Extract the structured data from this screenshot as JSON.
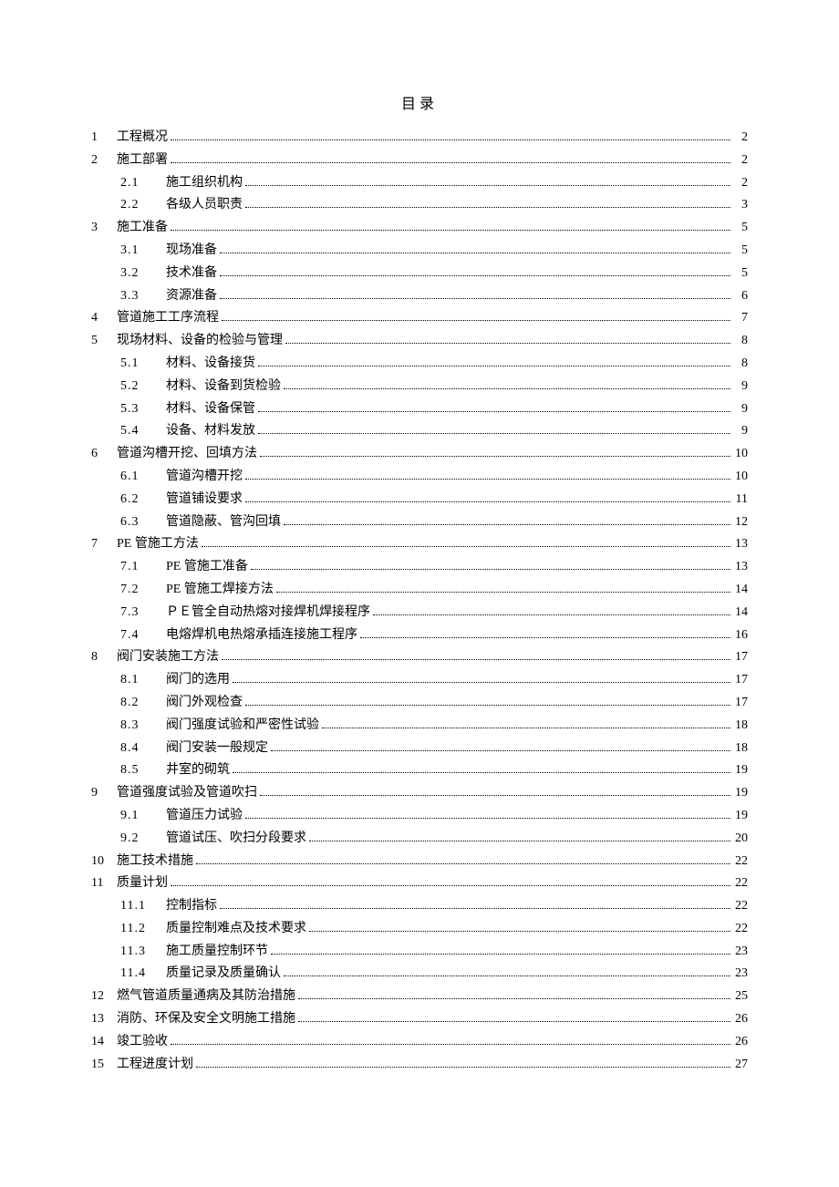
{
  "title": "目录",
  "entries": [
    {
      "level": 1,
      "num": "1",
      "text": "工程概况",
      "page": "2"
    },
    {
      "level": 1,
      "num": "2",
      "text": "施工部署",
      "page": "2"
    },
    {
      "level": 2,
      "num": "2.1",
      "text": "施工组织机构",
      "page": "2"
    },
    {
      "level": 2,
      "num": "2.2",
      "text": "各级人员职责",
      "page": "3"
    },
    {
      "level": 1,
      "num": "3",
      "text": "施工准备",
      "page": "5"
    },
    {
      "level": 2,
      "num": "3.1",
      "text": "现场准备",
      "page": "5"
    },
    {
      "level": 2,
      "num": "3.2",
      "text": "技术准备",
      "page": "5"
    },
    {
      "level": 2,
      "num": "3.3",
      "text": "资源准备",
      "page": "6"
    },
    {
      "level": 1,
      "num": "4",
      "text": "管道施工工序流程",
      "page": "7"
    },
    {
      "level": 1,
      "num": "5",
      "text": "现场材料、设备的检验与管理",
      "page": "8"
    },
    {
      "level": 2,
      "num": "5.1",
      "text": "材料、设备接货",
      "page": "8"
    },
    {
      "level": 2,
      "num": "5.2",
      "text": "材料、设备到货检验",
      "page": "9"
    },
    {
      "level": 2,
      "num": "5.3",
      "text": "材料、设备保管",
      "page": "9"
    },
    {
      "level": 2,
      "num": "5.4",
      "text": "设备、材料发放",
      "page": "9"
    },
    {
      "level": 1,
      "num": "6",
      "text": "管道沟槽开挖、回填方法",
      "page": "10"
    },
    {
      "level": 2,
      "num": "6.1",
      "text": "管道沟槽开挖",
      "page": "10"
    },
    {
      "level": 2,
      "num": "6.2",
      "text": "管道铺设要求",
      "page": "11"
    },
    {
      "level": 2,
      "num": "6.3",
      "text": "管道隐蔽、管沟回填",
      "page": "12"
    },
    {
      "level": 1,
      "num": "7",
      "text": "PE 管施工方法",
      "page": "13"
    },
    {
      "level": 2,
      "num": "7.1",
      "text": "PE 管施工准备",
      "page": "13"
    },
    {
      "level": 2,
      "num": "7.2",
      "text": "PE 管施工焊接方法",
      "page": "14"
    },
    {
      "level": 2,
      "num": "7.3",
      "text": "ＰＥ管全自动热熔对接焊机焊接程序",
      "page": "14"
    },
    {
      "level": 2,
      "num": "7.4",
      "text": "电熔焊机电热熔承插连接施工程序",
      "page": "16"
    },
    {
      "level": 1,
      "num": "8",
      "text": "阀门安装施工方法",
      "page": "17"
    },
    {
      "level": 2,
      "num": "8.1",
      "text": "阀门的选用",
      "page": "17"
    },
    {
      "level": 2,
      "num": "8.2",
      "text": "阀门外观检查",
      "page": "17"
    },
    {
      "level": 2,
      "num": "8.3",
      "text": "阀门强度试验和严密性试验",
      "page": "18"
    },
    {
      "level": 2,
      "num": "8.4",
      "text": "阀门安装一般规定",
      "page": "18"
    },
    {
      "level": 2,
      "num": "8.5",
      "text": "井室的砌筑",
      "page": "19"
    },
    {
      "level": 1,
      "num": "9",
      "text": "管道强度试验及管道吹扫",
      "page": "19"
    },
    {
      "level": 2,
      "num": "9.1",
      "text": "管道压力试验",
      "page": "19"
    },
    {
      "level": 2,
      "num": "9.2",
      "text": "管道试压、吹扫分段要求",
      "page": "20"
    },
    {
      "level": 1,
      "num": "10",
      "text": "施工技术措施",
      "page": "22"
    },
    {
      "level": 1,
      "num": "11",
      "text": "质量计划",
      "page": "22"
    },
    {
      "level": 2,
      "num": "11.1",
      "text": "控制指标",
      "page": "22"
    },
    {
      "level": 2,
      "num": "11.2",
      "text": "质量控制难点及技术要求",
      "page": "22"
    },
    {
      "level": 2,
      "num": "11.3",
      "text": "施工质量控制环节",
      "page": "23"
    },
    {
      "level": 2,
      "num": "11.4",
      "text": "质量记录及质量确认",
      "page": "23"
    },
    {
      "level": 1,
      "num": "12",
      "text": "燃气管道质量通病及其防治措施",
      "page": "25"
    },
    {
      "level": 1,
      "num": "13",
      "text": "消防、环保及安全文明施工措施",
      "page": "26"
    },
    {
      "level": 1,
      "num": "14",
      "text": "竣工验收",
      "page": "26"
    },
    {
      "level": 1,
      "num": "15",
      "text": "工程进度计划",
      "page": "27"
    }
  ]
}
